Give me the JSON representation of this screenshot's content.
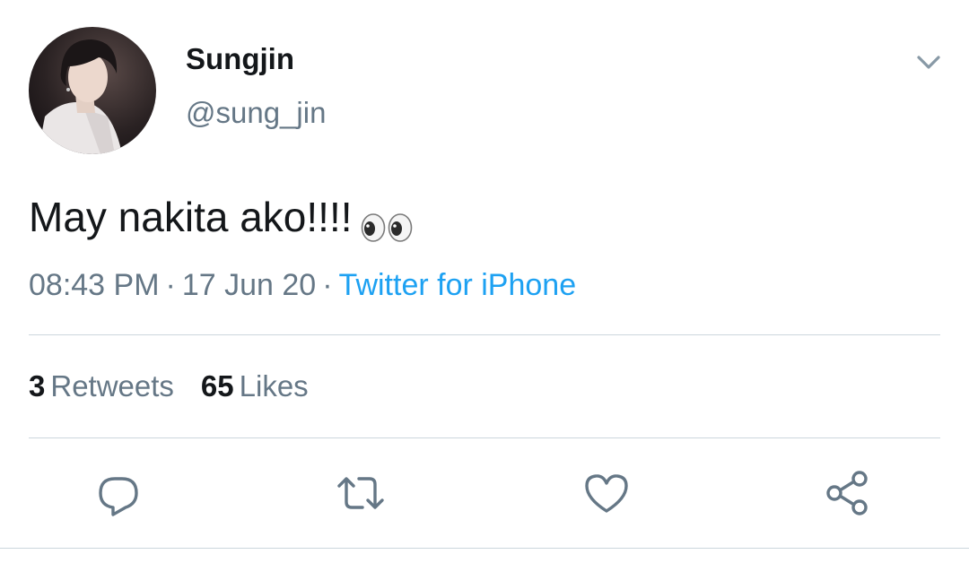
{
  "user": {
    "display_name": "Sungjin",
    "handle": "@sung_jin"
  },
  "tweet": {
    "text": "May nakita ako!!!!",
    "emoji": "eyes-emoji"
  },
  "meta": {
    "time": "08:43 PM",
    "date": "17 Jun 20",
    "separator": "·",
    "source": "Twitter for iPhone"
  },
  "stats": {
    "retweets_count": "3",
    "retweets_label": "Retweets",
    "likes_count": "65",
    "likes_label": "Likes"
  },
  "actions": {
    "reply_icon": "reply-icon",
    "retweet_icon": "retweet-icon",
    "like_icon": "heart-icon",
    "share_icon": "share-icon"
  },
  "colors": {
    "text_primary": "#14171a",
    "text_secondary": "#657786",
    "link": "#1da1f2",
    "divider": "#ccd6dd"
  }
}
